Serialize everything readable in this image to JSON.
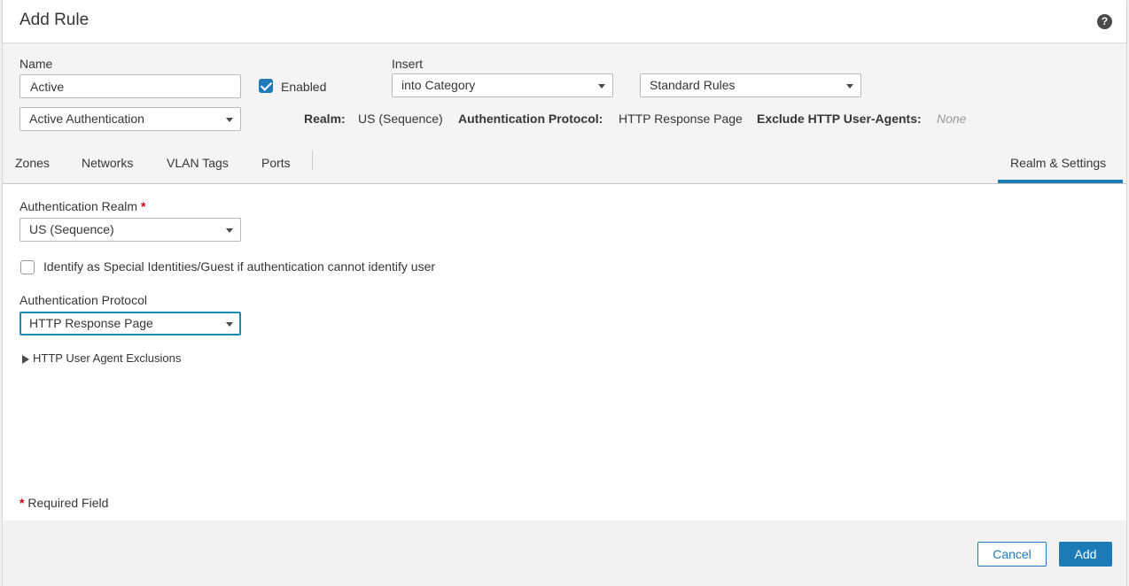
{
  "dialog": {
    "title": "Add Rule",
    "help_icon": "?"
  },
  "form": {
    "name_label": "Name",
    "name_value": "Active",
    "enabled_label": "Enabled",
    "enabled_checked": true,
    "insert_label": "Insert",
    "insert_value": "into Category",
    "category_value": "Standard Rules",
    "action_value": "Active Authentication"
  },
  "summary": {
    "realm_label": "Realm:",
    "realm_value": "US (Sequence)",
    "auth_protocol_label": "Authentication Protocol:",
    "auth_protocol_value": "HTTP Response Page",
    "exclude_label": "Exclude HTTP User-Agents:",
    "exclude_value": "None"
  },
  "tabs": {
    "items": [
      {
        "label": "Zones"
      },
      {
        "label": "Networks"
      },
      {
        "label": "VLAN Tags"
      },
      {
        "label": "Ports"
      },
      {
        "label": "Realm & Settings"
      }
    ],
    "active": "Realm & Settings"
  },
  "realm_settings": {
    "auth_realm_label": "Authentication Realm",
    "required_star": "*",
    "auth_realm_value": "US (Sequence)",
    "identify_label": "Identify as Special Identities/Guest if authentication cannot identify user",
    "identify_checked": false,
    "auth_protocol_label": "Authentication Protocol",
    "auth_protocol_value": "HTTP Response Page",
    "exclusions_label": "HTTP User Agent Exclusions"
  },
  "footer": {
    "required_note_star": "*",
    "required_note": "Required Field",
    "cancel_label": "Cancel",
    "add_label": "Add"
  },
  "colors": {
    "accent": "#1d7bb7",
    "required": "#d0021b"
  }
}
